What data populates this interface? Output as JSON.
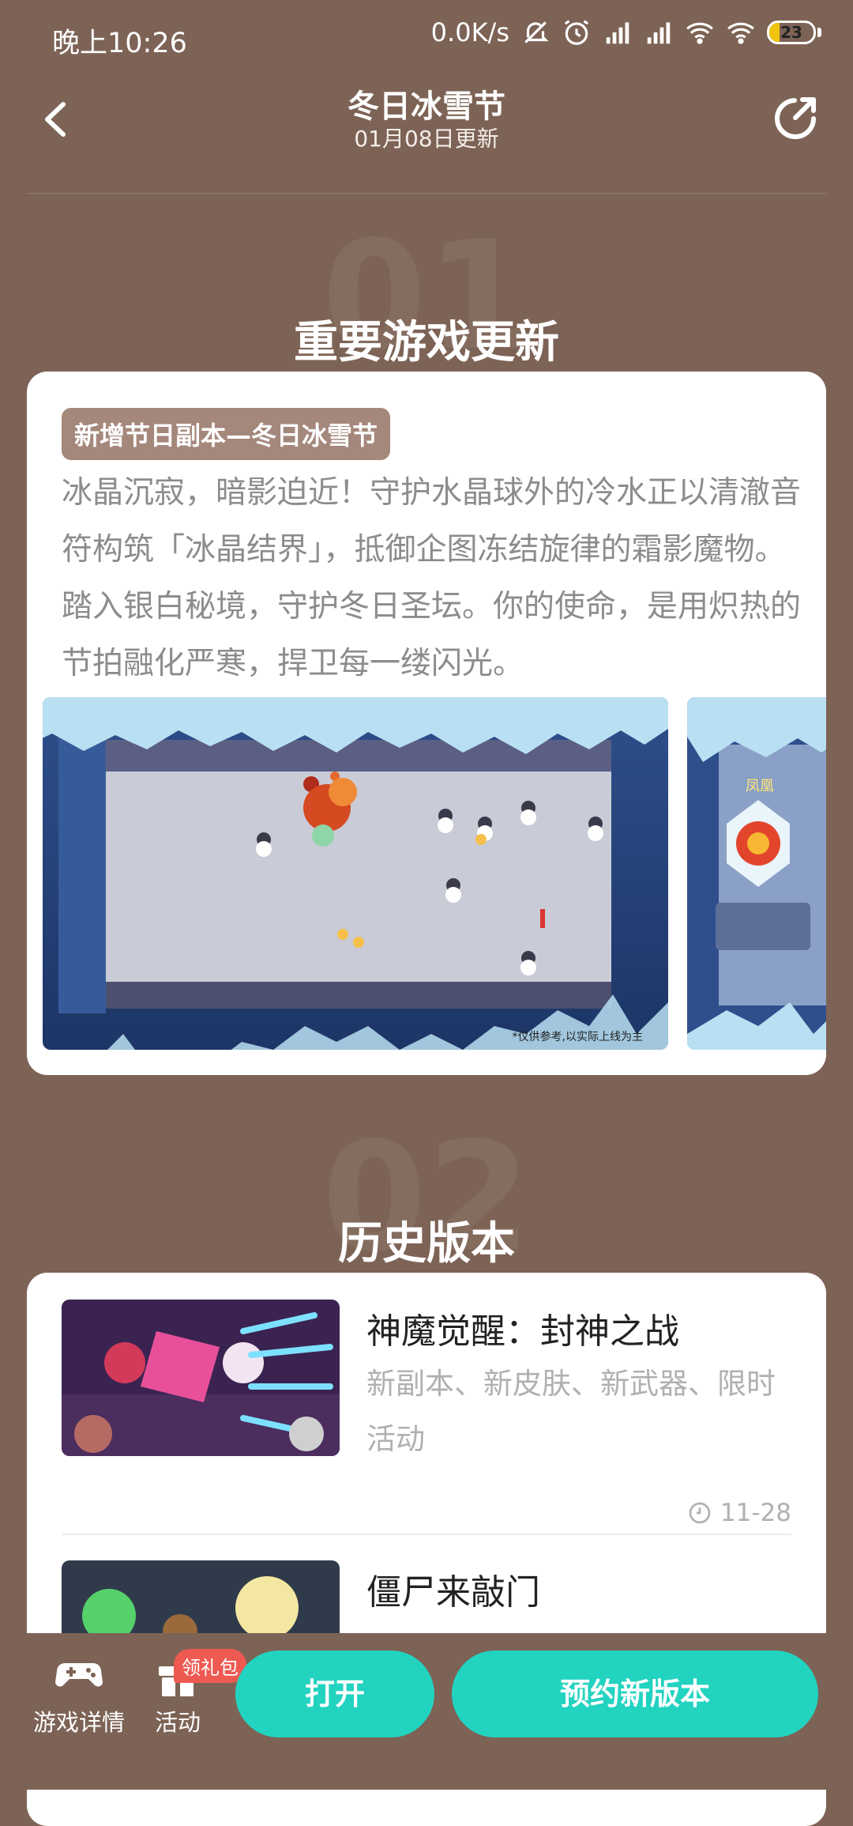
{
  "status_bar": {
    "time": "晚上10:26",
    "network_speed": "0.0K/s",
    "battery_level": "23",
    "icons": [
      "mute-bell-icon",
      "alarm-icon",
      "hd-signal-icon",
      "hd-signal-icon",
      "wifi-calling-icon",
      "wifi-icon",
      "battery-icon"
    ]
  },
  "header": {
    "title": "冬日冰雪节",
    "subtitle": "01月08日更新",
    "back_icon": "chevron-left-icon",
    "share_icon": "share-icon"
  },
  "section_important": {
    "number": "01",
    "title": "重要游戏更新",
    "tag": "新增节日副本—冬日冰雪节",
    "description": "冰晶沉寂，暗影迫近！守护水晶球外的冷水正以清澈音符构筑「冰晶结界」，抵御企图冻结旋律的霜影魔物。踏入银白秘境，守护冬日圣坛。你的使命，是用炽热的节拍融化严寒，捍卫每一缕闪光。",
    "screenshot1_caption": "*仅供参考,以实际上线为主",
    "screenshot2_label": "凤凰"
  },
  "section_history": {
    "number": "02",
    "title": "历史版本",
    "items": [
      {
        "name": "神魔觉醒：封神之战",
        "desc": "新副本、新皮肤、新武器、限时活动",
        "date": "11-28"
      },
      {
        "name": "僵尸来敲门",
        "desc": "",
        "date": ""
      }
    ]
  },
  "bottom_bar": {
    "tab_details": "游戏详情",
    "tab_activity": "活动",
    "gift_badge": "领礼包",
    "open_button": "打开",
    "reserve_button": "预约新版本"
  },
  "colors": {
    "background": "#7d6356",
    "accent": "#22d3c0",
    "tag_bg": "#a5887c",
    "badge": "#ee5a52"
  }
}
